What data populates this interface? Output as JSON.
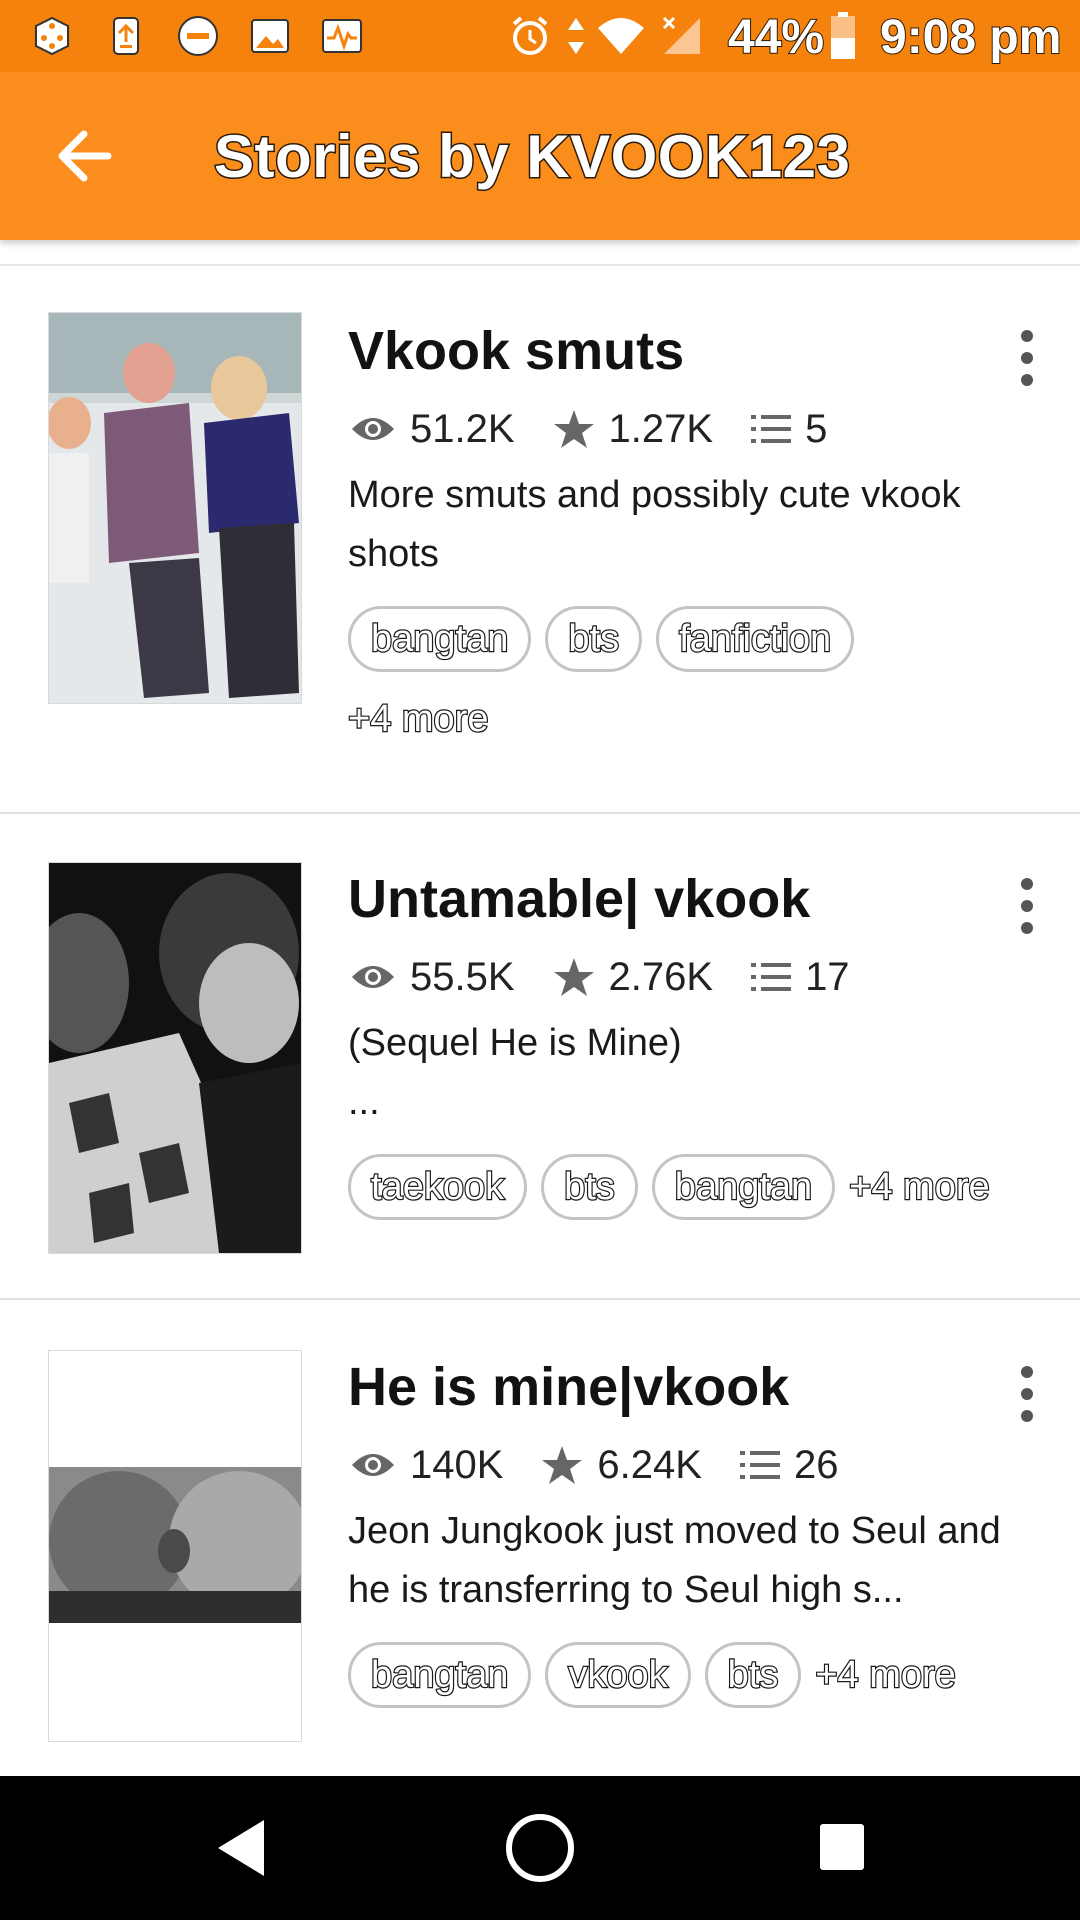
{
  "status_bar": {
    "battery": "44%",
    "time": "9:08 pm",
    "icons": [
      "dice-icon",
      "upload-icon",
      "dnd-icon",
      "image-icon",
      "pulse-icon",
      "alarm-icon",
      "data-arrows-icon",
      "wifi-icon",
      "signal-icon",
      "battery-icon"
    ]
  },
  "app_bar": {
    "title": "Stories by KVOOK123",
    "back_icon": "arrow-left-icon",
    "color": "#fa8d1c"
  },
  "stories": [
    {
      "title": "Vkook smuts",
      "reads": "51.2K",
      "votes": "1.27K",
      "parts": "5",
      "description": "More smuts and possibly cute vkook shots",
      "tags": [
        "bangtan",
        "bts",
        "fanfiction"
      ],
      "more": "+4 more"
    },
    {
      "title": "Untamable| vkook",
      "reads": "55.5K",
      "votes": "2.76K",
      "parts": "17",
      "description": "(Sequel He is Mine)\n...",
      "tags": [
        "taekook",
        "bts",
        "bangtan"
      ],
      "more": "+4 more"
    },
    {
      "title": "He is mine|vkook",
      "reads": "140K",
      "votes": "6.24K",
      "parts": "26",
      "description": "Jeon Jungkook just moved to Seul and he is transferring to Seul high s...",
      "tags": [
        "bangtan",
        "vkook",
        "bts"
      ],
      "more": "+4 more"
    }
  ],
  "nav_bar": {
    "icons": [
      "back-triangle-icon",
      "home-circle-icon",
      "recents-square-icon"
    ]
  }
}
